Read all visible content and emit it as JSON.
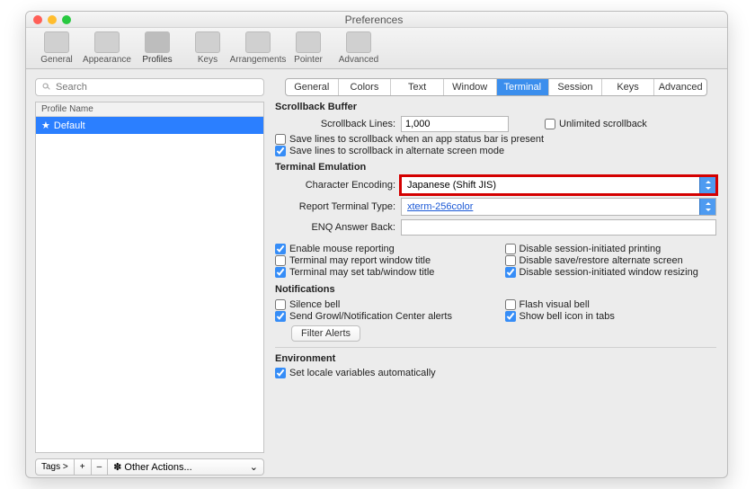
{
  "window": {
    "title": "Preferences"
  },
  "toolbar": {
    "items": [
      {
        "label": "General"
      },
      {
        "label": "Appearance"
      },
      {
        "label": "Profiles"
      },
      {
        "label": "Keys"
      },
      {
        "label": "Arrangements"
      },
      {
        "label": "Pointer"
      },
      {
        "label": "Advanced"
      }
    ]
  },
  "sidebar": {
    "search_placeholder": "Search",
    "header": "Profile Name",
    "rows": [
      {
        "star": "★",
        "name": "Default"
      }
    ],
    "tags_label": "Tags >",
    "plus": "+",
    "minus": "–",
    "other_actions": "✽ Other Actions...",
    "caret": "⌄"
  },
  "tabs": [
    "General",
    "Colors",
    "Text",
    "Window",
    "Terminal",
    "Session",
    "Keys",
    "Advanced"
  ],
  "scrollback": {
    "title": "Scrollback Buffer",
    "lines_label": "Scrollback Lines:",
    "lines_value": "1,000",
    "unlimited_label": "Unlimited scrollback",
    "save_status_label": "Save lines to scrollback when an app status bar is present",
    "save_alt_label": "Save lines to scrollback in alternate screen mode"
  },
  "emulation": {
    "title": "Terminal Emulation",
    "encoding_label": "Character Encoding:",
    "encoding_value": "Japanese (Shift JIS)",
    "report_label": "Report Terminal Type:",
    "report_value": "xterm-256color",
    "enq_label": "ENQ Answer Back:",
    "enq_value": "",
    "col1": {
      "mouse": "Enable mouse reporting",
      "wtitle": "Terminal may report window title",
      "tabtitle": "Terminal may set tab/window title"
    },
    "col2": {
      "printing": "Disable session-initiated printing",
      "altscreen": "Disable save/restore alternate screen",
      "resize": "Disable session-initiated window resizing"
    }
  },
  "notifications": {
    "title": "Notifications",
    "silence": "Silence bell",
    "growl": "Send Growl/Notification Center alerts",
    "flash": "Flash visual bell",
    "showicon": "Show bell icon in tabs",
    "filter_btn": "Filter Alerts"
  },
  "environment": {
    "title": "Environment",
    "locale": "Set locale variables automatically"
  }
}
